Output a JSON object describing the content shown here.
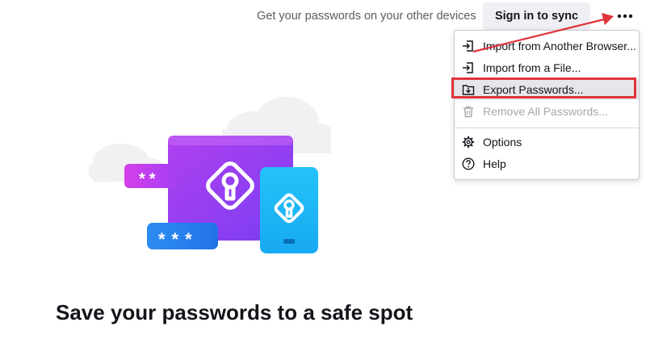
{
  "header": {
    "sync_prompt": "Get your passwords on your other devices",
    "sync_button_label": "Sign in to sync",
    "menu_button_icon": "more-options-icon"
  },
  "menu": {
    "items": [
      {
        "label": "Import from Another Browser...",
        "icon": "import-icon",
        "disabled": false
      },
      {
        "label": "Import from a File...",
        "icon": "import-icon",
        "disabled": false
      },
      {
        "label": "Export Passwords...",
        "icon": "export-icon",
        "disabled": false,
        "highlighted": true
      },
      {
        "label": "Remove All Passwords...",
        "icon": "trash-icon",
        "disabled": true
      },
      {
        "label": "Options",
        "icon": "gear-icon",
        "disabled": false
      },
      {
        "label": "Help",
        "icon": "help-icon",
        "disabled": false
      }
    ]
  },
  "illustration": {
    "password_mask_small": "**",
    "password_mask_large": "***"
  },
  "main": {
    "headline": "Save your passwords to a safe spot"
  },
  "colors": {
    "annotation_red": "#e0343c",
    "laptop_purple": "#9f3ff5",
    "phone_blue": "#20b9f7",
    "pill_pink": "#c43ff0",
    "pill_blue": "#2e86f0"
  }
}
